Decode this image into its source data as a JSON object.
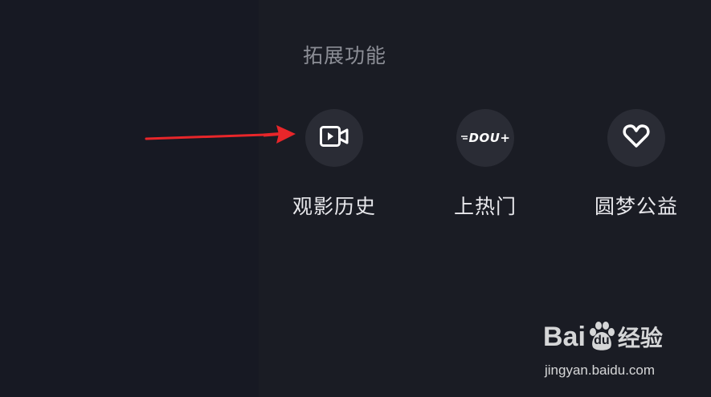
{
  "section": {
    "title": "拓展功能"
  },
  "features": [
    {
      "label": "观影历史",
      "icon": "video-play-icon"
    },
    {
      "label": "上热门",
      "icon": "dou-plus-icon",
      "icon_text": "DOU+"
    },
    {
      "label": "圆梦公益",
      "icon": "heart-icon"
    }
  ],
  "annotation": {
    "arrow_color": "#e8262a",
    "arrow_target": "观影历史"
  },
  "watermark": {
    "logo_text_a": "Bai",
    "logo_text_b": "du",
    "logo_suffix": "经验",
    "url": "jingyan.baidu.com"
  },
  "colors": {
    "background": "#181a22",
    "icon_circle": "#2a2c35",
    "label": "#e8e8ec",
    "section_title": "#8c8e96"
  }
}
